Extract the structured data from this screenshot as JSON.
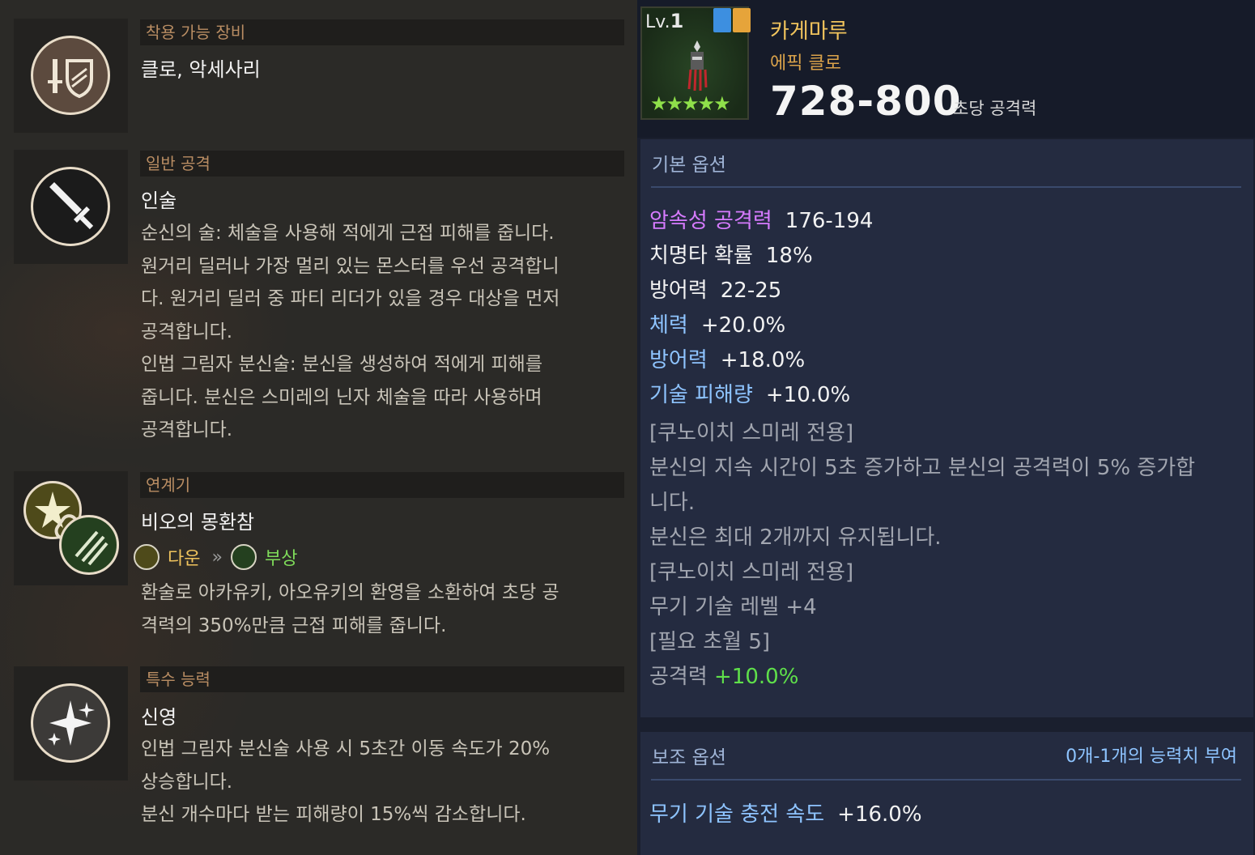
{
  "left": {
    "equip": {
      "header": "착용 가능 장비",
      "text": "클로, 악세사리"
    },
    "normal_attack": {
      "header": "일반 공격",
      "title": "인술",
      "lines": [
        "순신의 술: 체술을 사용해 적에게 근접 피해를 줍니다.",
        "원거리 딜러나 가장 멀리 있는 몬스터를 우선 공격합니",
        "다. 원거리 딜러 중 파티 리더가 있을 경우 대상을 먼저",
        "공격합니다.",
        "인법 그림자 분신술: 분신을 생성하여 적에게 피해를",
        "줍니다. 분신은 스미레의 닌자 체술을 따라 사용하며",
        "공격합니다."
      ]
    },
    "chain": {
      "header": "연계기",
      "title": "비오의 몽환참",
      "from": "다운",
      "to": "부상",
      "lines": [
        "환술로 아카유키, 아오유키의 환영을 소환하여 초당 공",
        "격력의 350%만큼 근접 피해를 줍니다."
      ]
    },
    "special": {
      "header": "특수 능력",
      "title": "신영",
      "lines": [
        "인법 그림자 분신술 사용 시 5초간 이동 속도가 20%",
        "상승합니다.",
        "분신 개수마다 받는 피해량이 15%씩 감소합니다."
      ]
    }
  },
  "item": {
    "level_prefix": "Lv.",
    "level": "1",
    "stars": "★★★★★",
    "star_count": 5,
    "name": "카게마루",
    "grade": "에픽 클로",
    "dps": "728-800",
    "dps_label": "초당 공격력"
  },
  "base_options": {
    "title": "기본 옵션",
    "stats": [
      {
        "key": "암속성 공격력",
        "value": "176-194",
        "color": "#d77bff"
      },
      {
        "key": "치명타 확률",
        "value": "18%",
        "color": "#f2f2f2"
      },
      {
        "key": "방어력",
        "value": "22-25",
        "color": "#f2f2f2"
      },
      {
        "key": "체력",
        "value": "+20.0%",
        "color": "#8ec4ff"
      },
      {
        "key": "방어력",
        "value": "+18.0%",
        "color": "#8ec4ff"
      },
      {
        "key": "기술 피해량",
        "value": "+10.0%",
        "color": "#8ec4ff"
      }
    ],
    "notes": [
      "[쿠노이치 스미레 전용]",
      "분신의 지속 시간이 5초 증가하고 분신의 공격력이 5% 증가합",
      "니다.",
      "분신은 최대 2개까지 유지됩니다.",
      "[쿠노이치 스미레 전용]",
      "무기 기술 레벨 +4",
      "[필요 초월 5]"
    ],
    "last_key": "공격력",
    "last_value": "+10.0%"
  },
  "sub_options": {
    "title": "보조 옵션",
    "range": "0개-1개의 능력치 부여",
    "stat_key": "무기 기술 충전 속도",
    "stat_value": "+16.0%"
  },
  "colors": {
    "accent_gold": "#f1c45d",
    "header_brown": "#b98d63",
    "option_blue": "#8ec4ff",
    "dark_purple": "#d77bff",
    "bonus_green": "#5fe04a"
  }
}
